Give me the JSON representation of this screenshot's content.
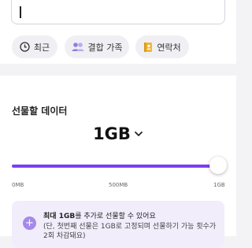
{
  "search": {
    "value": ""
  },
  "filters": [
    {
      "label": "최근",
      "icon": "clock-icon"
    },
    {
      "label": "결합 가족",
      "icon": "people-icon"
    },
    {
      "label": "연락처",
      "icon": "contacts-book-icon"
    }
  ],
  "gift": {
    "section_title": "선물할 데이터",
    "amount": "1GB",
    "slider": {
      "min_label": "0MB",
      "mid_label": "500MB",
      "max_label": "1GB",
      "value_fraction": 1.0
    },
    "notice": {
      "line1_bold": "최대 1GB",
      "line1_rest": "를 추가로 선물할 수 있어요",
      "line2": "(단, 첫번째 선물은 1GB로 고정되며 선물하기 가능 횟수가",
      "line3": "2회 차감돼요)"
    }
  },
  "colors": {
    "accent": "#7a3ff3",
    "notice_bg": "#f1edfb",
    "page_bg": "#f3f3f6"
  }
}
